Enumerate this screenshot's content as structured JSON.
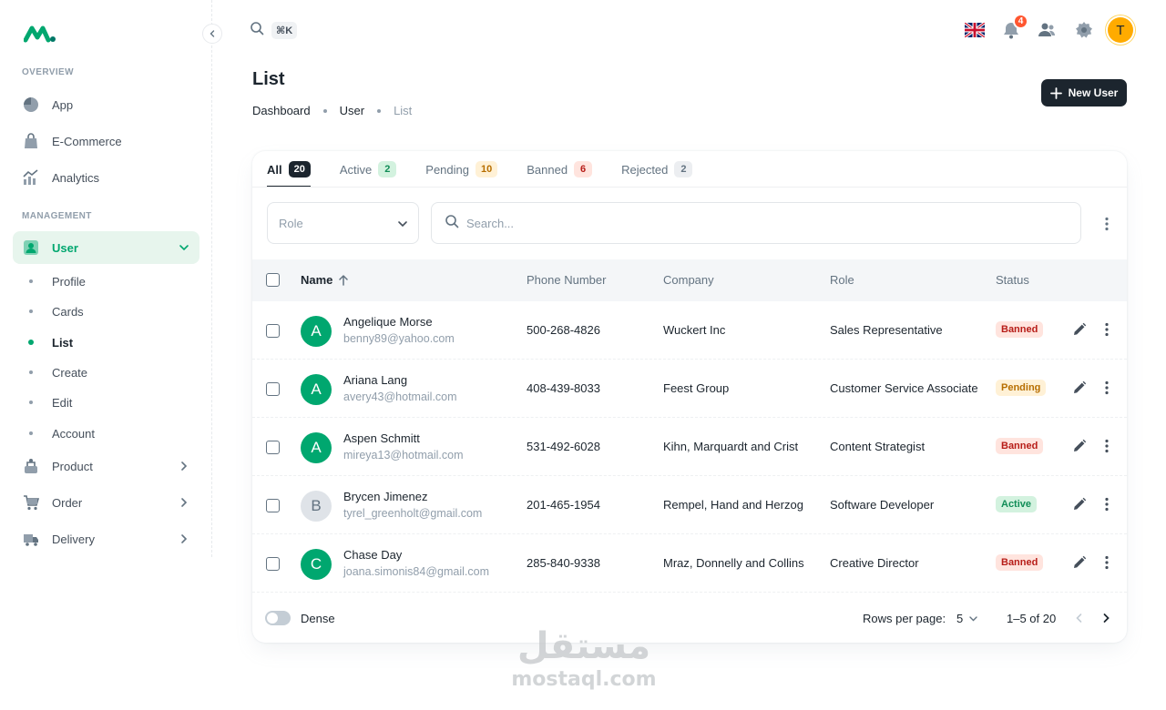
{
  "sidebar": {
    "subheaders": {
      "overview": "OVERVIEW",
      "management": "MANAGEMENT"
    },
    "overview_items": [
      {
        "label": "App",
        "icon": "app-icon"
      },
      {
        "label": "E-Commerce",
        "icon": "bag-icon"
      },
      {
        "label": "Analytics",
        "icon": "analytics-icon"
      }
    ],
    "user": {
      "label": "User",
      "icon": "user-icon",
      "expanded": true
    },
    "user_children": [
      "Profile",
      "Cards",
      "List",
      "Create",
      "Edit",
      "Account"
    ],
    "active_child": "List",
    "management_items": [
      {
        "label": "Product",
        "icon": "product-icon"
      },
      {
        "label": "Order",
        "icon": "cart-icon"
      },
      {
        "label": "Delivery",
        "icon": "truck-icon"
      }
    ]
  },
  "header": {
    "search_shortcut": "⌘K",
    "notification_count": "4",
    "language_icon": "uk-flag-icon",
    "avatar_letter": "T",
    "avatar_color": "#ffab00"
  },
  "page": {
    "title": "List",
    "breadcrumb": [
      "Dashboard",
      "User",
      "List"
    ],
    "new_user_label": "New User"
  },
  "tabs": [
    {
      "label": "All",
      "count": "20",
      "bg": "#1c252e",
      "fg": "#ffffff",
      "active": true
    },
    {
      "label": "Active",
      "count": "2",
      "bg": "#d3f2df",
      "fg": "#118d57",
      "active": false
    },
    {
      "label": "Pending",
      "count": "10",
      "bg": "#fff1d6",
      "fg": "#b76e00",
      "active": false
    },
    {
      "label": "Banned",
      "count": "6",
      "bg": "#ffe4de",
      "fg": "#b71d18",
      "active": false
    },
    {
      "label": "Rejected",
      "count": "2",
      "bg": "#eceef1",
      "fg": "#637381",
      "active": false
    }
  ],
  "filters": {
    "role_placeholder": "Role",
    "search_placeholder": "Search..."
  },
  "table": {
    "columns": [
      "Name",
      "Phone Number",
      "Company",
      "Role",
      "Status"
    ],
    "rows": [
      {
        "initial": "A",
        "avatar_color": "#00a76f",
        "name": "Angelique Morse",
        "email": "benny89@yahoo.com",
        "phone": "500-268-4826",
        "company": "Wuckert Inc",
        "role": "Sales Representative",
        "status": "Banned"
      },
      {
        "initial": "A",
        "avatar_color": "#00a76f",
        "name": "Ariana Lang",
        "email": "avery43@hotmail.com",
        "phone": "408-439-8033",
        "company": "Feest Group",
        "role": "Customer Service Associate",
        "status": "Pending"
      },
      {
        "initial": "A",
        "avatar_color": "#00a76f",
        "name": "Aspen Schmitt",
        "email": "mireya13@hotmail.com",
        "phone": "531-492-6028",
        "company": "Kihn, Marquardt and Crist",
        "role": "Content Strategist",
        "status": "Banned"
      },
      {
        "initial": "B",
        "avatar_color": "#dfe3e8",
        "name": "Brycen Jimenez",
        "email": "tyrel_greenholt@gmail.com",
        "phone": "201-465-1954",
        "company": "Rempel, Hand and Herzog",
        "role": "Software Developer",
        "status": "Active"
      },
      {
        "initial": "C",
        "avatar_color": "#00a76f",
        "name": "Chase Day",
        "email": "joana.simonis84@gmail.com",
        "phone": "285-840-9338",
        "company": "Mraz, Donnelly and Collins",
        "role": "Creative Director",
        "status": "Banned"
      }
    ],
    "status_colors": {
      "Banned": {
        "bg": "#ffe4de",
        "fg": "#b71d18"
      },
      "Pending": {
        "bg": "#fff1d6",
        "fg": "#b76e00"
      },
      "Active": {
        "bg": "#d3f2df",
        "fg": "#118d57"
      }
    }
  },
  "footer": {
    "dense_label": "Dense",
    "rows_per_page_label": "Rows per page:",
    "rows_per_page_value": "5",
    "page_info": "1–5 of 20"
  },
  "watermark": {
    "arabic": "مستقل",
    "latin": "mostaql.com"
  }
}
